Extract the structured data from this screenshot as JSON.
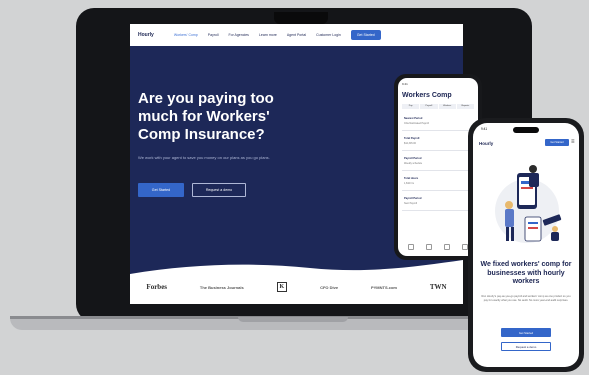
{
  "laptop": {
    "nav": {
      "logo": "Hourly",
      "items": [
        "Workers' Comp",
        "Payroll",
        "For Agencies",
        "Learn more",
        "Agent Portal",
        "Customer Login"
      ],
      "cta": "Get Started"
    },
    "hero": {
      "headline": "Are you paying too much for Workers' Comp Insurance?",
      "subtext": "We work with your agent to save you money on our plans as you go plans.",
      "primary_button": "Get Started",
      "secondary_button": "Request a demo"
    },
    "press_logos": [
      "Forbes",
      "The Business Journals",
      "K",
      "CFO Dive",
      "PYMNTS.com",
      "TWN"
    ]
  },
  "phone_small": {
    "status": "9:41",
    "title": "Workers Comp",
    "tabs": [
      "Pay",
      "Payroll",
      "Workers",
      "Reports"
    ],
    "rows": [
      {
        "label": "Nearest Period",
        "value": "Chief Estimated Payroll"
      },
      {
        "label": "Total Payroll",
        "value": "$12,345.00"
      },
      {
        "label": "Payroll Period",
        "value": "Weekly schedule"
      },
      {
        "label": "Total Hours",
        "value": "1,842 hrs"
      },
      {
        "label": "Payroll Period",
        "value": "Next Payroll"
      }
    ]
  },
  "phone_large": {
    "status": "9:41",
    "logo": "Hourly",
    "cta": "Get Started",
    "headline": "We fixed workers' comp for businesses with hourly workers",
    "subtext": "Run Hourly's pay-as-you-go payroll and workers' comp as one product so you pay for exactly what you use. No audit. No more year-end audit surprises.",
    "primary_button": "Get Started",
    "secondary_button": "Request a demo"
  },
  "colors": {
    "navy": "#1d2858",
    "accent": "#3466c9",
    "background": "#d2d3d4"
  }
}
